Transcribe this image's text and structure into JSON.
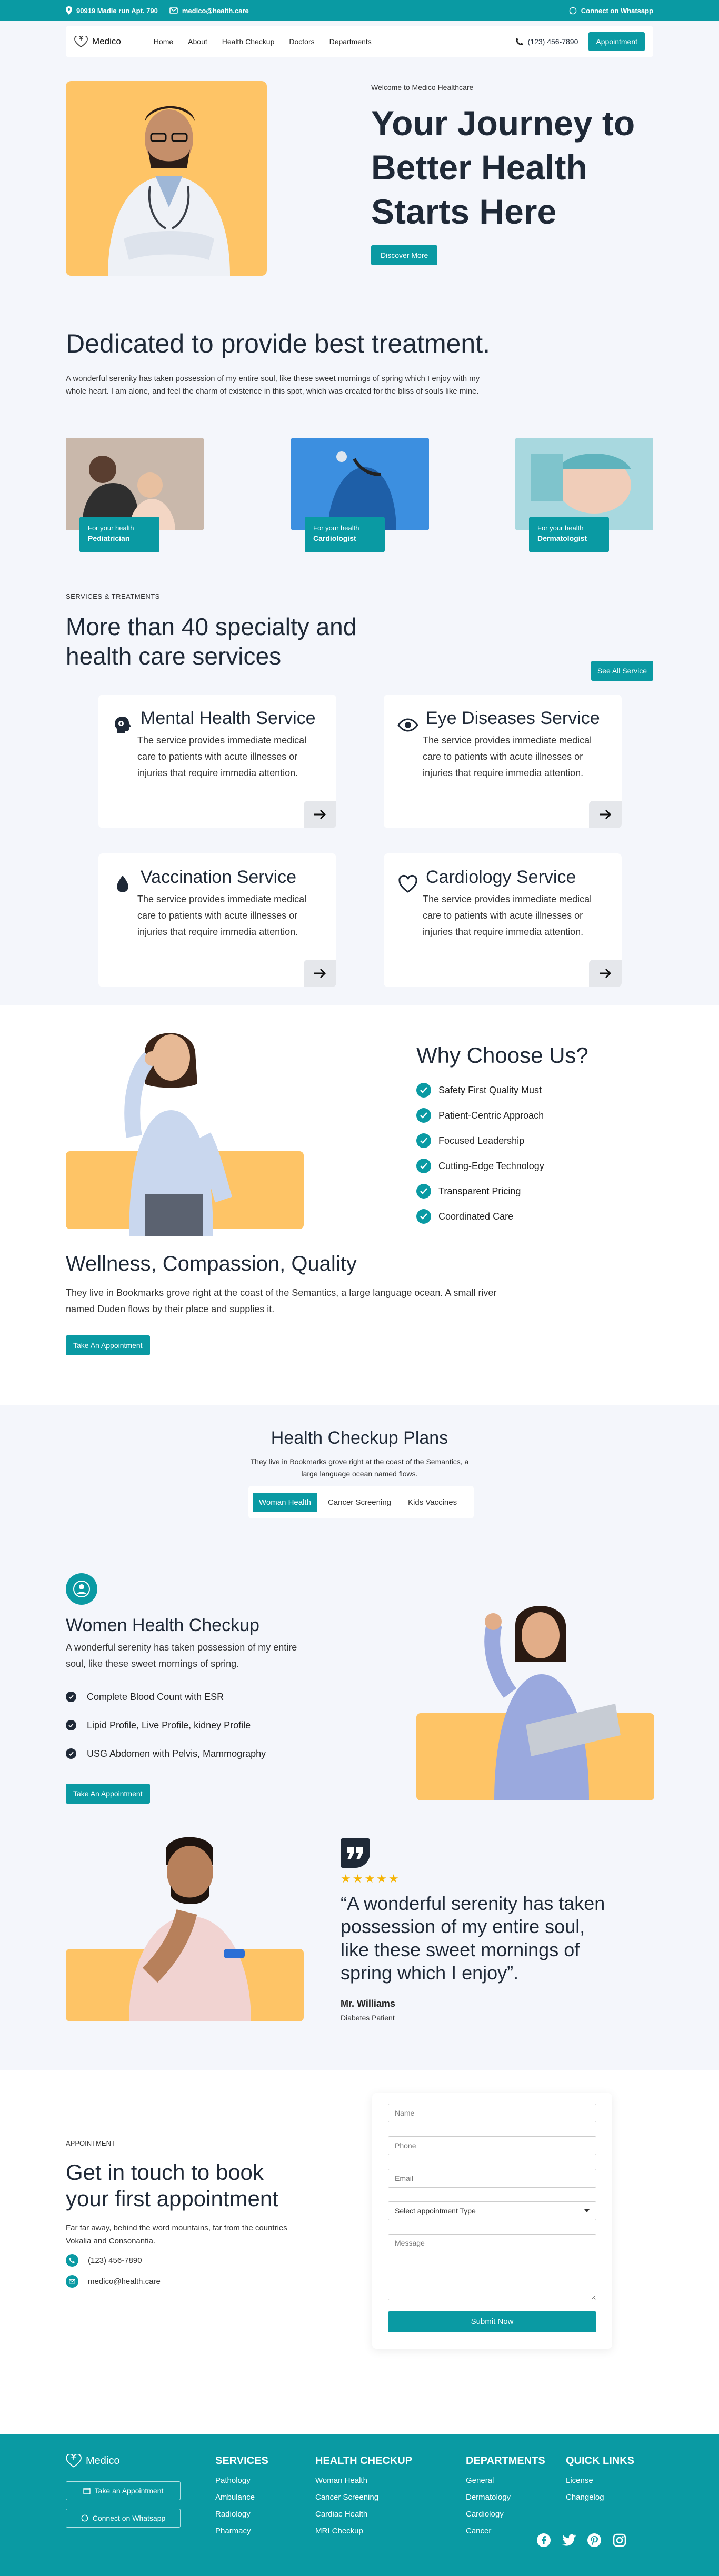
{
  "colors": {
    "primary": "#0a9aa3",
    "accent": "#fec466",
    "text": "#1f2937",
    "bg_light": "#f4f6fb"
  },
  "topbar": {
    "address": "90919 Madie run Apt. 790",
    "email": "medico@health.care",
    "whatsapp": "Connect on Whatsapp"
  },
  "nav": {
    "logo": "Medico",
    "items": [
      "Home",
      "About",
      "Health Checkup",
      "Doctors",
      "Departments"
    ],
    "phone": "(123) 456-7890",
    "appointment": "Appointment"
  },
  "hero": {
    "welcome": "Welcome to Medico Healthcare",
    "headline_lines": [
      "Your Journey to",
      "Better Health",
      "Starts Here"
    ],
    "cta": "Discover More"
  },
  "dedicated": {
    "title": "Dedicated to provide best treatment.",
    "text": "A wonderful serenity has taken possession of my entire soul, like these sweet mornings of spring which I enjoy with my whole heart. I am alone, and feel the charm of existence in this spot, which was created for the bliss of souls like mine."
  },
  "team": [
    {
      "prefix": "For your health",
      "role": "Pediatrician"
    },
    {
      "prefix": "For your health",
      "role": "Cardiologist"
    },
    {
      "prefix": "For your health",
      "role": "Dermatologist"
    }
  ],
  "services": {
    "tag": "SERVICES & TREATMENTS",
    "title": "More than 40 specialty and health care services",
    "see_all": "See All Service",
    "cards": [
      {
        "title": "Mental Health Service",
        "text": "The service provides immediate medical care to patients with acute illnesses or injuries that require immedia attention.",
        "icon": "brain-icon"
      },
      {
        "title": "Eye Diseases Service",
        "text": "The service provides immediate medical care to patients with acute illnesses or injuries that require immedia attention.",
        "icon": "eye-icon"
      },
      {
        "title": "Vaccination Service",
        "text": "The service provides immediate medical care to patients with acute illnesses or injuries that require immedia attention.",
        "icon": "drop-icon"
      },
      {
        "title": "Cardiology Service",
        "text": "The service provides immediate medical care to patients with acute illnesses or injuries that require immedia attention.",
        "icon": "heart-icon"
      }
    ]
  },
  "why": {
    "title": "Why Choose Us?",
    "items": [
      "Safety First Quality Must",
      "Patient-Centric Approach",
      "Focused Leadership",
      "Cutting-Edge Technology",
      "Transparent Pricing",
      "Coordinated Care"
    ]
  },
  "wellness": {
    "title": "Wellness, Compassion, Quality",
    "text": "They live in Bookmarks grove right at the coast of the Semantics, a large language ocean. A small river named Duden flows by their place and supplies it.",
    "cta": "Take An Appointment"
  },
  "plans": {
    "title": "Health Checkup Plans",
    "text": "They live in Bookmarks grove right at the coast of the Semantics, a large language ocean named flows.",
    "tabs": [
      "Woman Health",
      "Cancer Screening",
      "Kids Vaccines"
    ],
    "active_tab": "Woman Health",
    "plan": {
      "title": "Women Health Checkup",
      "text": "A wonderful serenity has taken possession of my entire soul, like these sweet mornings of spring.",
      "items": [
        "Complete Blood Count with ESR",
        "Lipid Profile, Live Profile, kidney Profile",
        "USG Abdomen with Pelvis, Mammography"
      ],
      "cta": "Take An Appointment"
    }
  },
  "testimonial": {
    "stars": "★★★★★",
    "rating": 5,
    "quote": "“A wonderful serenity has taken possession of my entire soul, like these sweet mornings of spring which I enjoy”.",
    "name": "Mr. Williams",
    "role": "Diabetes Patient"
  },
  "appointment": {
    "tag": "APPOINTMENT",
    "title": "Get in touch to book your first appointment",
    "text": "Far far away, behind the word mountains, far from the countries Vokalia and Consonantia.",
    "phone": "(123) 456-7890",
    "email": "medico@health.care",
    "form": {
      "name_ph": "Name",
      "phone_ph": "Phone",
      "email_ph": "Email",
      "select": "Select appointment Type",
      "message_ph": "Message",
      "submit": "Submit Now"
    }
  },
  "footer": {
    "logo": "Medico",
    "btn_appointment": "Take an Appointment",
    "btn_whatsapp": "Connect on Whatsapp",
    "columns": [
      {
        "title": "SERVICES",
        "links": [
          "Pathology",
          "Ambulance",
          "Radiology",
          "Pharmacy"
        ]
      },
      {
        "title": "HEALTH CHECKUP",
        "links": [
          "Woman Health",
          "Cancer Screening",
          "Cardiac Health",
          "MRI Checkup"
        ]
      },
      {
        "title": "DEPARTMENTS",
        "links": [
          "General",
          "Dermatology",
          "Cardiology",
          "Cancer"
        ]
      },
      {
        "title": "QUICK LINKS",
        "links": [
          "License",
          "Changelog"
        ]
      }
    ],
    "social": [
      "facebook-icon",
      "twitter-icon",
      "pinterest-icon",
      "instagram-icon"
    ]
  }
}
